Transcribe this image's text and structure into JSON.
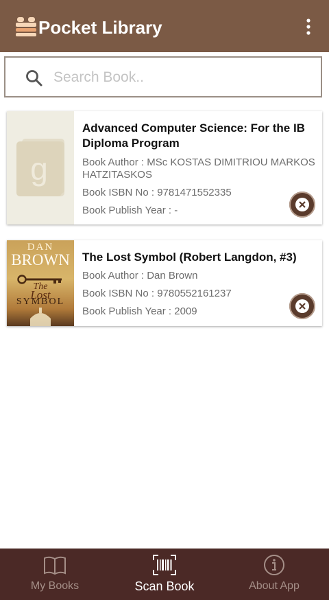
{
  "app": {
    "title": "Pocket Library",
    "logo_icon": "stacked-books-icon",
    "menu_icon": "overflow-menu-icon",
    "colors": {
      "appbar": "#7b5a45",
      "bottom_nav": "#4b2926",
      "delete_button": "#5a3b2c"
    }
  },
  "search": {
    "placeholder": "Search Book..",
    "value": "",
    "icon": "search-icon"
  },
  "books": [
    {
      "title": "Advanced Computer Science: For the IB Diploma Program",
      "author": "Book Author : MSc KOSTAS DIMITRIOU MARKOS HATZITASKOS",
      "isbn": "Book ISBN No : 9781471552335",
      "year": "Book Publish Year :  -",
      "cover_icon": "google-books-placeholder-icon"
    },
    {
      "title": "The Lost Symbol (Robert Langdon, #3)",
      "author": "Book Author : Dan Brown",
      "isbn": "Book ISBN No : 9780552161237",
      "year": "Book Publish Year : 2009",
      "cover": {
        "line1": "DAN",
        "line2": "BROWN",
        "line3": "The",
        "line4": "Lost",
        "line5": "SYMBOL"
      }
    }
  ],
  "bottom_nav": {
    "items": [
      {
        "label": "My Books",
        "icon": "open-book-icon",
        "active": false
      },
      {
        "label": "Scan Book",
        "icon": "barcode-scan-icon",
        "active": true
      },
      {
        "label": "About App",
        "icon": "info-icon",
        "active": false
      }
    ]
  }
}
